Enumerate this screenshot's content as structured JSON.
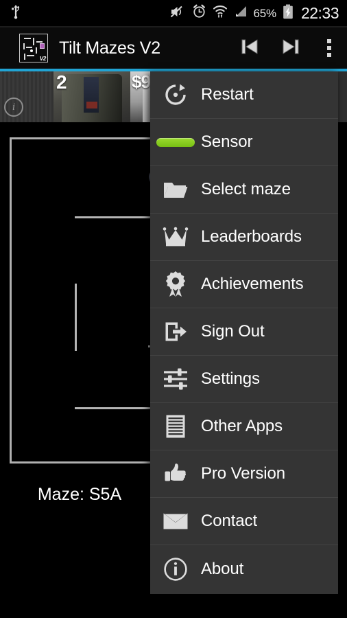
{
  "status_bar": {
    "left_icons": [
      "usb-icon"
    ],
    "right_icons": [
      "mute-icon",
      "alarm-icon",
      "wifi-icon",
      "signal-icon",
      "battery-charging-icon"
    ],
    "battery_percent": "65%",
    "clock": "22:33"
  },
  "action_bar": {
    "app_icon_label": "V2",
    "title": "Tilt Mazes V2",
    "actions": [
      {
        "name": "previous-button",
        "icon": "skip-previous-icon"
      },
      {
        "name": "next-button",
        "icon": "skip-next-icon"
      },
      {
        "name": "overflow-button",
        "icon": "overflow-menu-icon"
      }
    ],
    "accent_color": "#21a4d4"
  },
  "ad_banner": {
    "info_badge": "i",
    "price_labels": [
      "2",
      "$9",
      "$9"
    ]
  },
  "game": {
    "maze_label": "Maze: S5A",
    "maze_id": "S5A",
    "wall_color": "#b4b4b4",
    "background_color": "#000000"
  },
  "menu": {
    "background": "#343434",
    "items": [
      {
        "label": "Restart",
        "icon": "restart-icon",
        "name": "menu-item-restart"
      },
      {
        "label": "Sensor",
        "icon": "toggle-on-icon",
        "name": "menu-item-sensor",
        "toggle": true,
        "toggle_color": "#88cc22"
      },
      {
        "label": "Select maze",
        "icon": "folder-icon",
        "name": "menu-item-select-maze"
      },
      {
        "label": "Leaderboards",
        "icon": "crown-icon",
        "name": "menu-item-leaderboards"
      },
      {
        "label": "Achievements",
        "icon": "award-icon",
        "name": "menu-item-achievements"
      },
      {
        "label": "Sign Out",
        "icon": "sign-out-icon",
        "name": "menu-item-sign-out"
      },
      {
        "label": "Settings",
        "icon": "sliders-icon",
        "name": "menu-item-settings"
      },
      {
        "label": "Other Apps",
        "icon": "list-icon",
        "name": "menu-item-other-apps"
      },
      {
        "label": "Pro Version",
        "icon": "thumbs-up-icon",
        "name": "menu-item-pro-version"
      },
      {
        "label": "Contact",
        "icon": "envelope-icon",
        "name": "menu-item-contact"
      },
      {
        "label": "About",
        "icon": "info-circle-icon",
        "name": "menu-item-about"
      }
    ]
  }
}
